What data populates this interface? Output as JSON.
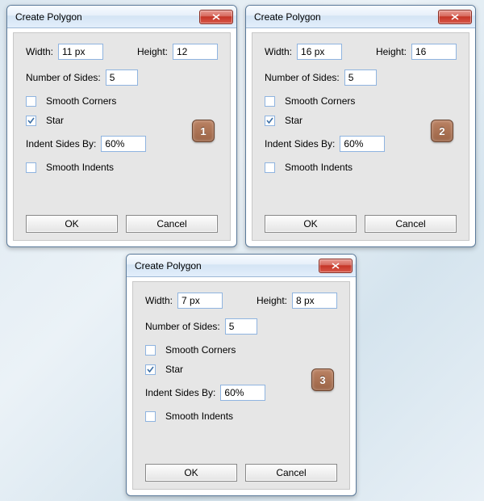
{
  "common": {
    "title": "Create Polygon",
    "width_label": "Width:",
    "height_label": "Height:",
    "sides_label": "Number of Sides:",
    "smooth_corners_label": "Smooth Corners",
    "star_label": "Star",
    "indent_label": "Indent Sides By:",
    "smooth_indents_label": "Smooth Indents",
    "ok_label": "OK",
    "cancel_label": "Cancel"
  },
  "dialogs": [
    {
      "badge": "1",
      "width": "11 px",
      "height": "12",
      "sides": "5",
      "smooth_corners": false,
      "star": true,
      "indent": "60%",
      "smooth_indents": false
    },
    {
      "badge": "2",
      "width": "16 px",
      "height": "16",
      "sides": "5",
      "smooth_corners": false,
      "star": true,
      "indent": "60%",
      "smooth_indents": false
    },
    {
      "badge": "3",
      "width": "7 px",
      "height": "8 px",
      "sides": "5",
      "smooth_corners": false,
      "star": true,
      "indent": "60%",
      "smooth_indents": false
    }
  ]
}
